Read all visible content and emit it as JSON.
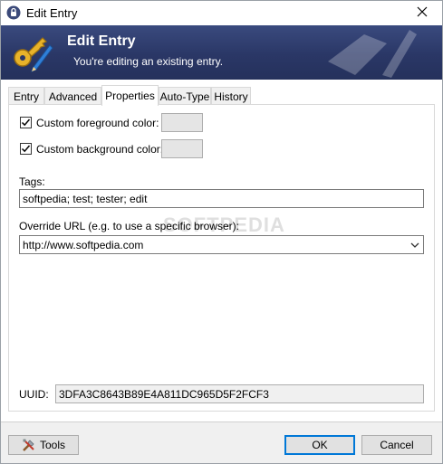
{
  "window": {
    "title": "Edit Entry"
  },
  "banner": {
    "title": "Edit Entry",
    "subtitle": "You're editing an existing entry."
  },
  "tabs": [
    {
      "label": "Entry",
      "active": false
    },
    {
      "label": "Advanced",
      "active": false
    },
    {
      "label": "Properties",
      "active": true
    },
    {
      "label": "Auto-Type",
      "active": false
    },
    {
      "label": "History",
      "active": false
    }
  ],
  "properties": {
    "foreground": {
      "label": "Custom foreground color:",
      "checked": true,
      "color": "#e5e5e5"
    },
    "background": {
      "label": "Custom background color:",
      "checked": true,
      "color": "#e5e5e5"
    },
    "tags_label": "Tags:",
    "tags_value": "softpedia; test; tester; edit",
    "override_url_label": "Override URL (e.g. to use a specific browser):",
    "override_url_value": "http://www.softpedia.com",
    "uuid_label": "UUID:",
    "uuid_value": "3DFA3C8643B89E4A811DC965D5F2FCF3",
    "watermark": "SOFTPEDIA"
  },
  "footer": {
    "tools_label": "Tools",
    "ok_label": "OK",
    "cancel_label": "Cancel"
  },
  "colors": {
    "banner": "#2a3766",
    "accent": "#0078d7",
    "footer_bg": "#f0f0f0"
  },
  "icons": {
    "title": "lock-icon",
    "close": "close-icon",
    "banner": "key-pencil-icon",
    "tools": "tools-icon",
    "dropdown": "chevron-down-icon"
  }
}
